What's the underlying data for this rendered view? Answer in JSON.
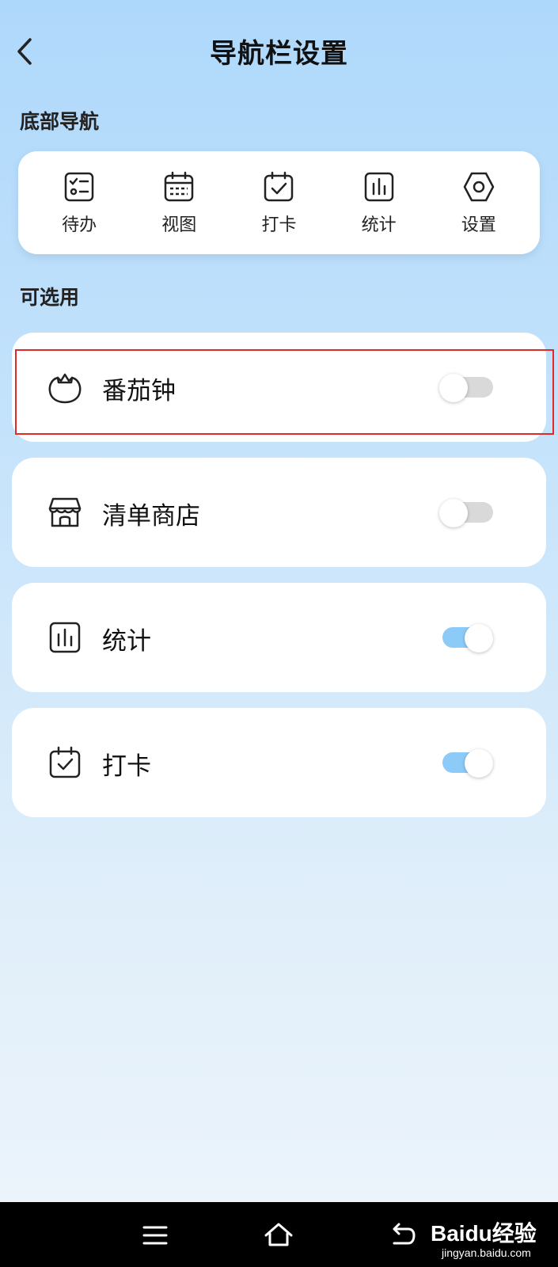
{
  "header": {
    "title": "导航栏设置",
    "back_icon": "chevron-left-icon"
  },
  "sections": {
    "bottom_nav_label": "底部导航",
    "optional_label": "可选用"
  },
  "bottom_nav": {
    "items": [
      {
        "label": "待办",
        "icon": "todo-list-icon"
      },
      {
        "label": "视图",
        "icon": "calendar-view-icon"
      },
      {
        "label": "打卡",
        "icon": "check-in-calendar-icon"
      },
      {
        "label": "统计",
        "icon": "bar-chart-icon"
      },
      {
        "label": "设置",
        "icon": "hexagon-settings-icon"
      }
    ]
  },
  "optional": {
    "items": [
      {
        "label": "番茄钟",
        "icon": "tomato-icon",
        "enabled": false
      },
      {
        "label": "清单商店",
        "icon": "store-icon",
        "enabled": false
      },
      {
        "label": "统计",
        "icon": "bar-chart-icon",
        "enabled": true
      },
      {
        "label": "打卡",
        "icon": "check-in-calendar-icon",
        "enabled": true
      }
    ]
  },
  "system_nav": {
    "menu_icon": "menu-icon",
    "home_icon": "home-icon",
    "back_icon": "back-arrow-icon"
  },
  "watermark": {
    "main": "Baidu经验",
    "sub": "jingyan.baidu.com"
  },
  "colors": {
    "toggle_on": "#8ccbf8",
    "toggle_off": "#d9d9d9",
    "highlight": "#e02a2a"
  }
}
